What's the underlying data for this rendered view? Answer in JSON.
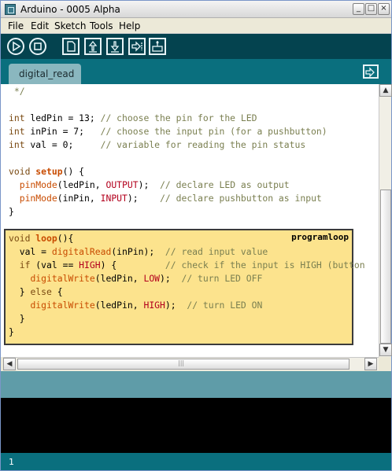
{
  "window": {
    "title": "Arduino - 0005 Alpha",
    "minimize_glyph": "_",
    "maximize_glyph": "□",
    "close_glyph": "×"
  },
  "menu": {
    "items": [
      "File",
      "Edit",
      "Sketch",
      "Tools",
      "Help"
    ]
  },
  "toolbar": {
    "buttons": [
      "play-icon",
      "stop-icon",
      "new-file-icon",
      "upload-icon",
      "download-icon",
      "export-icon",
      "serial-monitor-icon"
    ]
  },
  "tabs": {
    "active": "digital_read",
    "serial_icon": "serial-monitor-icon"
  },
  "editor": {
    "lines": [
      " */",
      "",
      "int ledPin = 13; // choose the pin for the LED",
      "int inPin = 7;   // choose the input pin (for a pushbutton)",
      "int val = 0;     // variable for reading the pin status",
      "",
      "void setup() {",
      "  pinMode(ledPin, OUTPUT);  // declare LED as output",
      "  pinMode(inPin, INPUT);    // declare pushbutton as input",
      "}",
      "",
      "void loop(){",
      "  val = digitalRead(inPin);  // read input value",
      "  if (val == HIGH) {         // check if the input is HIGH (button",
      "    digitalWrite(ledPin, LOW);  // turn LED OFF",
      "  } else {",
      "    digitalWrite(ledPin, HIGH);  // turn LED ON",
      "  }",
      "}"
    ],
    "loop_label": "programloop"
  },
  "scrollbars": {
    "up_arrow": "▲",
    "down_arrow": "▼",
    "left_arrow": "◀",
    "right_arrow": "▶",
    "grip": "|||"
  },
  "status": {
    "line_number": "1"
  },
  "colors": {
    "toolbar": "#04434f",
    "tabstrip": "#0a6f7e",
    "message_area": "#5f9ca8",
    "console": "#000000",
    "loop_highlight": "#fce38d",
    "keyword": "#7a4a12",
    "function": "#c84b00",
    "constant": "#b3001d",
    "comment": "#7a7f50"
  }
}
